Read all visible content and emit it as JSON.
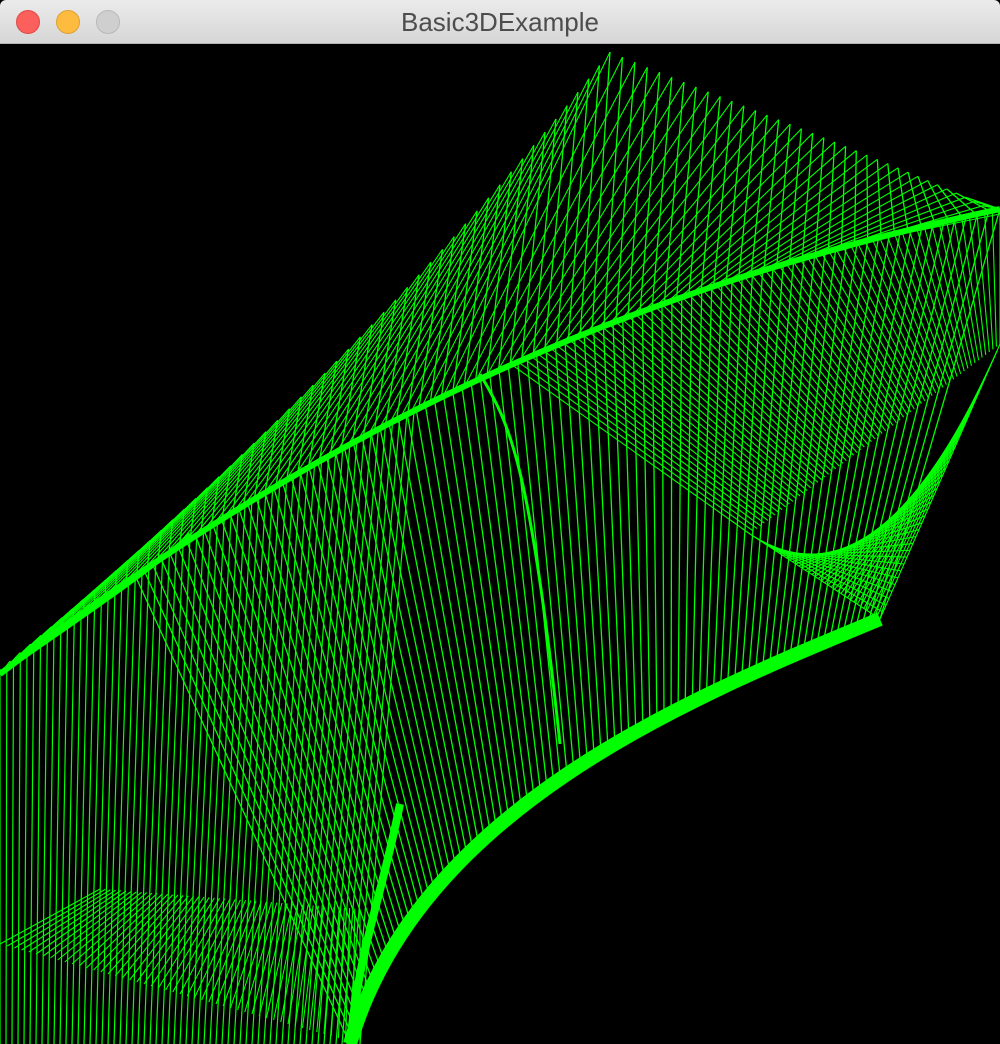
{
  "window": {
    "title": "Basic3DExample"
  },
  "titlebar": {
    "buttons": [
      "close",
      "minimize",
      "zoom"
    ]
  },
  "viewport": {
    "background": "#000000",
    "line_color": "#00ff00",
    "description_kind": "green wireframe surface"
  }
}
